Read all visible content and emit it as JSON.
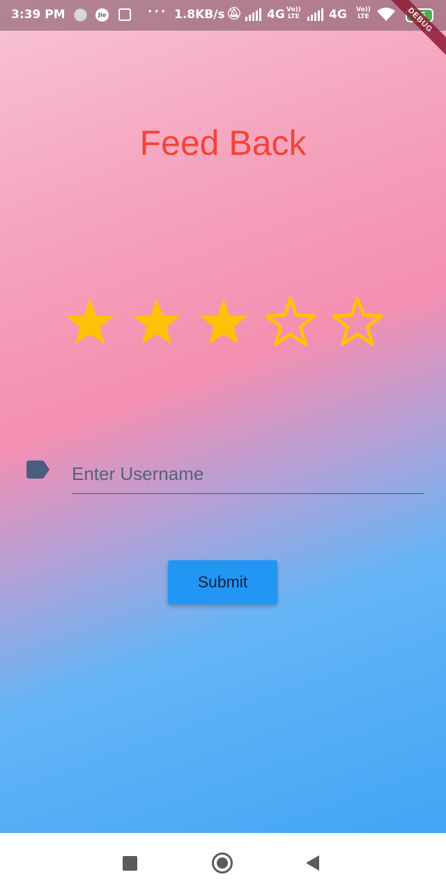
{
  "status_bar": {
    "time": "3:39 PM",
    "jio_label": "Jio",
    "more": "···",
    "network_speed": "1.8KB/s",
    "network_1": "4G",
    "network_2": "4G",
    "volte_1": "Vo))\nLTE",
    "volte_2": "Vo))\nLTE",
    "battery": "56",
    "icons": [
      "circle-icon",
      "jio-icon",
      "grid-icon",
      "bell-off-icon",
      "signal-icon",
      "signal-icon",
      "wifi-icon",
      "battery-icon"
    ]
  },
  "debug_banner": "DEBUG",
  "main": {
    "title": "Feed Back",
    "rating": {
      "value": 3,
      "max": 5
    },
    "username_input": {
      "placeholder": "Enter Username",
      "value": ""
    },
    "submit_label": "Submit"
  },
  "nav_bar": {
    "icons": [
      "recents-icon",
      "home-icon",
      "back-icon"
    ]
  },
  "colors": {
    "title": "#f44336",
    "star": "#ffc107",
    "button": "#2196f3",
    "gradient": [
      "#f8c4d7",
      "#f48fb1",
      "#64b5f6",
      "#42a5f5"
    ]
  }
}
